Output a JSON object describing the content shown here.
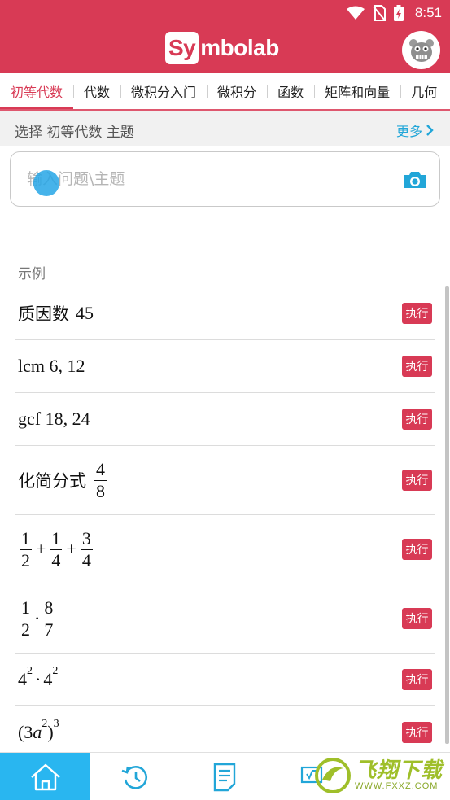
{
  "status": {
    "time": "8:51"
  },
  "header": {
    "logo_sy": "Sy",
    "logo_rest": "mbolab"
  },
  "tabs": [
    {
      "label": "初等代数",
      "active": true
    },
    {
      "label": "代数"
    },
    {
      "label": "微积分入门"
    },
    {
      "label": "微积分"
    },
    {
      "label": "函数"
    },
    {
      "label": "矩阵和向量"
    },
    {
      "label": "几何"
    }
  ],
  "topic": {
    "label": "选择 初等代数 主题",
    "more": "更多"
  },
  "search": {
    "placeholder": "输入问题\\主题"
  },
  "examples": {
    "title": "示例",
    "run_label": "执行",
    "items": [
      {
        "prefix": "质因数",
        "text": "45"
      },
      {
        "text": "lcm 6, 12"
      },
      {
        "text": "gcf 18, 24"
      },
      {
        "prefix": "化简分式",
        "num": "4",
        "den": "8"
      },
      {
        "a_num": "1",
        "a_den": "2",
        "op1": "+",
        "b_num": "1",
        "b_den": "4",
        "op2": "+",
        "c_num": "3",
        "c_den": "4"
      },
      {
        "a_num": "1",
        "a_den": "2",
        "op": "·",
        "b_num": "8",
        "b_den": "7"
      },
      {
        "base1": "4",
        "exp1": "2",
        "op": "·",
        "base2": "4",
        "exp2": "2"
      },
      {
        "open": "(3",
        "var": "a",
        "exp_in": "2",
        "close": ")",
        "exp_out": "3"
      }
    ]
  },
  "watermark": {
    "title": "飞翔下载",
    "url": "WWW.FXXZ.COM"
  },
  "colors": {
    "brand": "#d83a55",
    "accent": "#22a6d8",
    "nav_active": "#29b6f0"
  }
}
